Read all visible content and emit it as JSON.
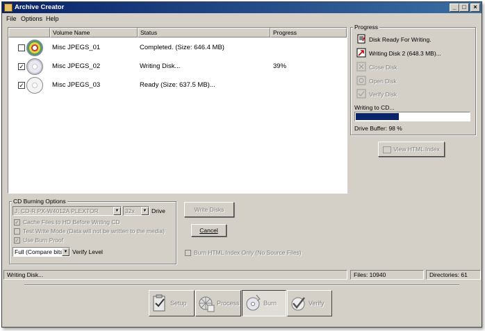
{
  "window": {
    "title": "Archive Creator",
    "min": "_",
    "max": "□",
    "close": "×"
  },
  "menu": [
    "File",
    "Options",
    "Help"
  ],
  "list": {
    "columns": [
      "",
      "Volume Name",
      "Status",
      "Progress"
    ],
    "rows": [
      {
        "checked": false,
        "name": "Misc JPEGS_01",
        "status": "Completed. (Size: 646.4 MB)",
        "progress": ""
      },
      {
        "checked": true,
        "name": "Misc JPEGS_02",
        "status": "Writing Disk...",
        "progress": "39%"
      },
      {
        "checked": true,
        "name": "Misc JPEGS_03",
        "status": "Ready (Size: 637.5 MB)...",
        "progress": ""
      }
    ]
  },
  "progress_panel": {
    "title": "Progress",
    "steps": [
      {
        "label": "Disk Ready For Writing.",
        "enabled": true
      },
      {
        "label": "Writing Disk 2 (648.3 MB)...",
        "enabled": true
      },
      {
        "label": "Close Disk",
        "enabled": false
      },
      {
        "label": "Open Disk",
        "enabled": false
      },
      {
        "label": "Verify Disk",
        "enabled": false
      }
    ],
    "writing_label": "Writing to CD...",
    "write_progress": 0.39,
    "drive_buffer": "Drive Buffer: 98 %",
    "view_html_index": "View HTML Index"
  },
  "burn_options": {
    "title": "CD Burning Options",
    "drive_value": "J: CD-R   PX-W4012A PLEXTOR",
    "speed_value": "32x",
    "drive_label": "Drive",
    "cache_label": "Cache Files to HD Before Writing CD",
    "test_label": "Test Write Mode (Data will not be written to the media)",
    "burnproof_label": "Use Burn Proof",
    "verify_value": "Full (Compare bits)",
    "verify_label": "Verify Level"
  },
  "actions": {
    "write_disks": "Write Disks",
    "cancel": "Cancel",
    "burn_html_only": "Burn HTML Index Only (No Source Files)"
  },
  "status": {
    "message": "Writing Disk...",
    "files": "Files: 10940",
    "directories": "Directories: 61"
  },
  "wizard": [
    {
      "label": "Setup",
      "active": false
    },
    {
      "label": "Process",
      "active": false
    },
    {
      "label": "Burn",
      "active": true
    },
    {
      "label": "Verify",
      "active": false
    }
  ],
  "colors": {
    "title_start": "#0a246a",
    "title_end": "#3a6ea5",
    "progress_fill": "#0a246a",
    "face": "#d4d0c8"
  }
}
